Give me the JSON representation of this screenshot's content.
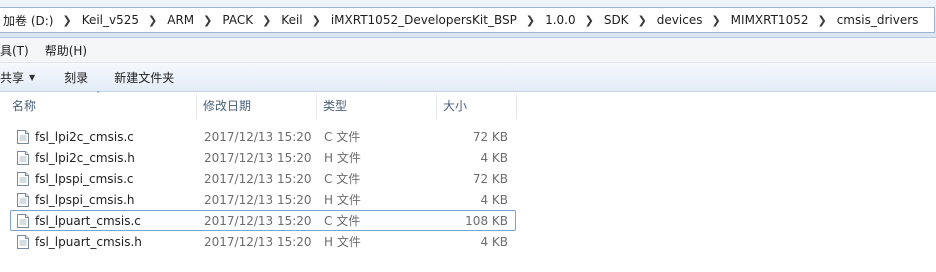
{
  "breadcrumbs": [
    "加卷 (D:)",
    "Keil_v525",
    "ARM",
    "PACK",
    "Keil",
    "iMXRT1052_DevelopersKit_BSP",
    "1.0.0",
    "SDK",
    "devices",
    "MIMXRT1052",
    "cmsis_drivers"
  ],
  "menu": [
    "具(T)",
    "帮助(H)"
  ],
  "toolbar": {
    "share": "共享",
    "burn": "刻录",
    "new_folder": "新建文件夹"
  },
  "columns": {
    "name": "名称",
    "date": "修改日期",
    "type": "类型",
    "size": "大小"
  },
  "files": [
    {
      "name": "fsl_lpi2c_cmsis.c",
      "date": "2017/12/13 15:20",
      "type": "C 文件",
      "size": "72 KB"
    },
    {
      "name": "fsl_lpi2c_cmsis.h",
      "date": "2017/12/13 15:20",
      "type": "H 文件",
      "size": "4 KB"
    },
    {
      "name": "fsl_lpspi_cmsis.c",
      "date": "2017/12/13 15:20",
      "type": "C 文件",
      "size": "72 KB"
    },
    {
      "name": "fsl_lpspi_cmsis.h",
      "date": "2017/12/13 15:20",
      "type": "H 文件",
      "size": "4 KB"
    },
    {
      "name": "fsl_lpuart_cmsis.c",
      "date": "2017/12/13 15:20",
      "type": "C 文件",
      "size": "108 KB"
    },
    {
      "name": "fsl_lpuart_cmsis.h",
      "date": "2017/12/13 15:20",
      "type": "H 文件",
      "size": "4 KB"
    }
  ],
  "focused_row": 4,
  "icons": {
    "file": "document-file-icon",
    "dropdown": "chevron-down-icon",
    "sort": "sort-ascending-icon"
  }
}
